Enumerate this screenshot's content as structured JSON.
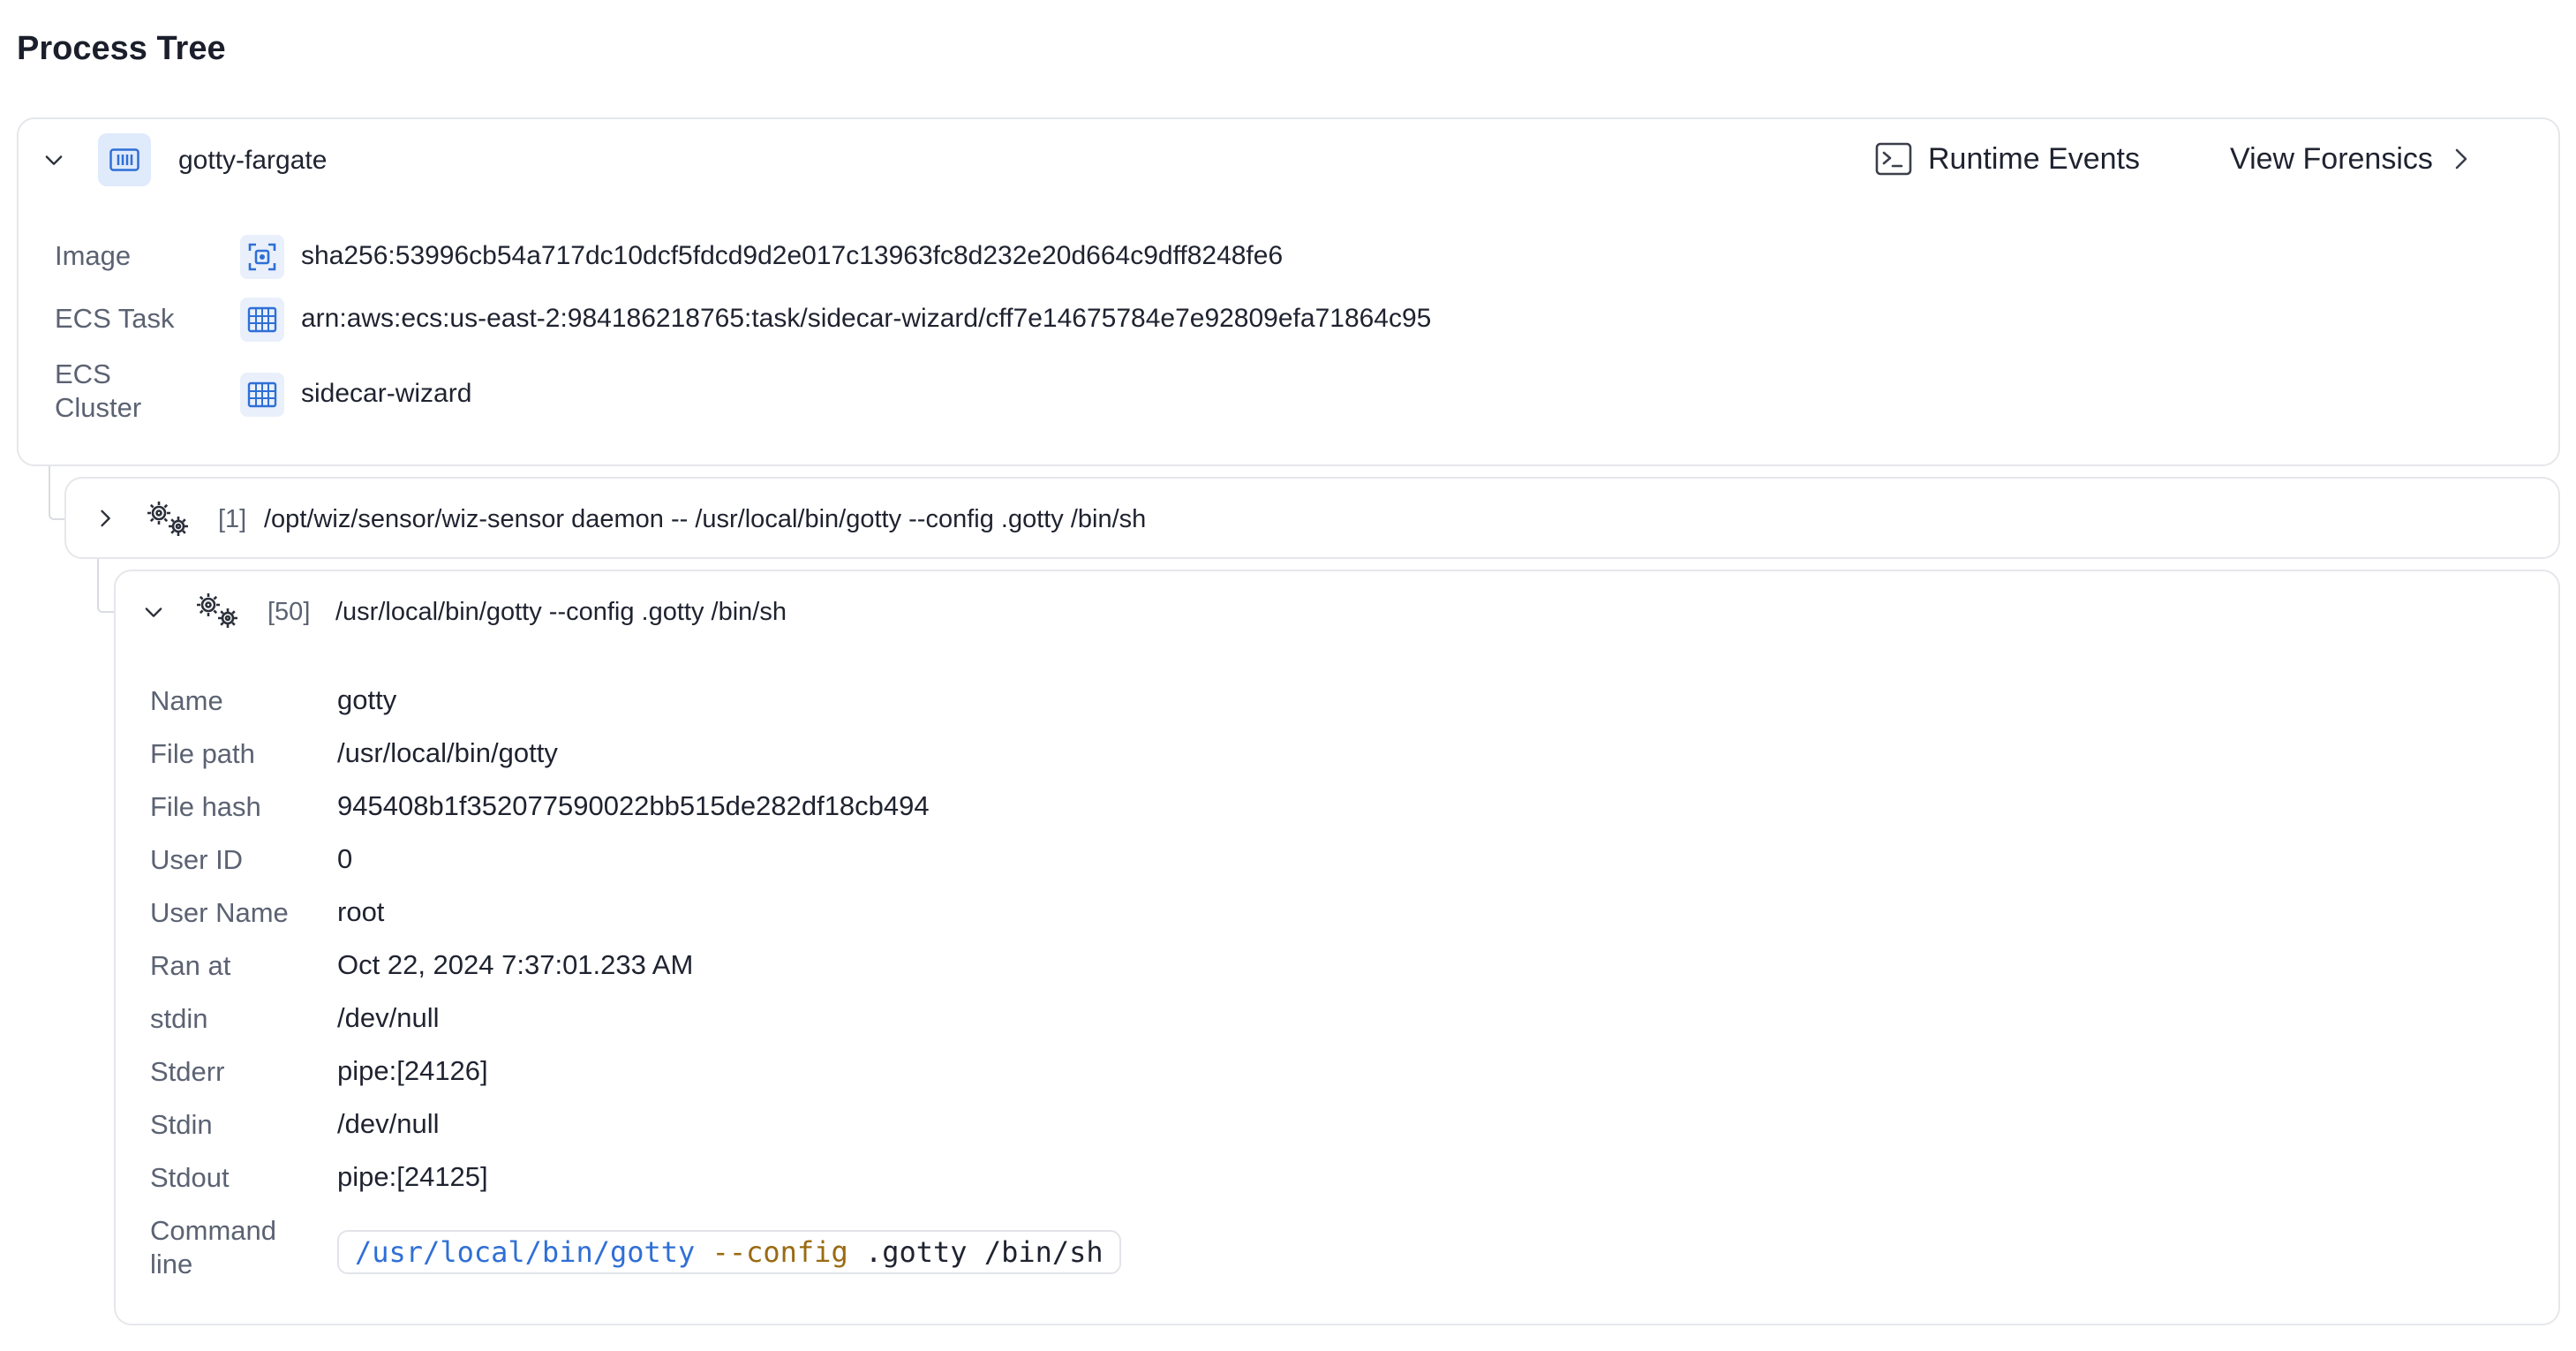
{
  "page": {
    "title": "Process Tree"
  },
  "container": {
    "name": "gotty-fargate",
    "icon": "container-icon",
    "actions": {
      "runtime_events": "Runtime Events",
      "view_forensics": "View Forensics"
    },
    "details": [
      {
        "label": "Image",
        "icon": "image-scan-icon",
        "value": "sha256:53996cb54a717dc10dcf5fdcd9d2e017c13963fc8d232e20d664c9dff8248fe6"
      },
      {
        "label": "ECS Task",
        "icon": "ecs-task-icon",
        "value": "arn:aws:ecs:us-east-2:984186218765:task/sidecar-wizard/cff7e14675784e7e92809efa71864c95"
      },
      {
        "label": "ECS Cluster",
        "icon": "ecs-cluster-icon",
        "value": "sidecar-wizard"
      }
    ]
  },
  "processes": [
    {
      "pid": "[1]",
      "command": "/opt/wiz/sensor/wiz-sensor daemon -- /usr/local/bin/gotty --config .gotty /bin/sh",
      "expanded": false
    },
    {
      "pid": "[50]",
      "command": "/usr/local/bin/gotty --config .gotty /bin/sh",
      "expanded": true,
      "details": [
        {
          "label": "Name",
          "value": "gotty"
        },
        {
          "label": "File path",
          "value": "/usr/local/bin/gotty"
        },
        {
          "label": "File hash",
          "value": "945408b1f352077590022bb515de282df18cb494"
        },
        {
          "label": "User ID",
          "value": "0"
        },
        {
          "label": "User Name",
          "value": "root"
        },
        {
          "label": "Ran at",
          "value": "Oct 22, 2024 7:37:01.233 AM"
        },
        {
          "label": "stdin",
          "value": "/dev/null"
        },
        {
          "label": "Stderr",
          "value": "pipe:[24126]"
        },
        {
          "label": "Stdin",
          "value": "/dev/null"
        },
        {
          "label": "Stdout",
          "value": "pipe:[24125]"
        }
      ],
      "command_line": {
        "label": "Command line",
        "tokens": [
          {
            "text": "/usr/local/bin/gotty",
            "kind": "path"
          },
          {
            "text": " ",
            "kind": "plain"
          },
          {
            "text": "--config",
            "kind": "flag"
          },
          {
            "text": " .gotty /bin/sh",
            "kind": "plain"
          }
        ]
      }
    }
  ],
  "colors": {
    "accent_blue": "#2f6fd6",
    "flag_gold": "#9a6a12",
    "border": "#e5e7eb",
    "muted_text": "#5b6272"
  }
}
